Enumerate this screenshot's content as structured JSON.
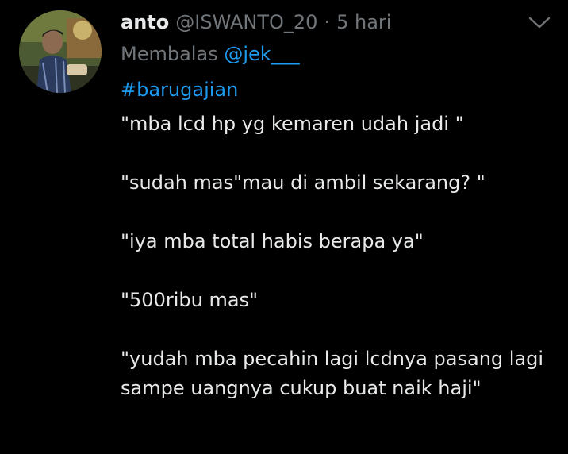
{
  "tweet": {
    "author_name": "anto",
    "author_handle": "@ISWANTO_20",
    "separator": "·",
    "timestamp": "5 hari",
    "reply_prefix": "Membalas",
    "reply_mention": "@jek___",
    "hashtag": "#barugajian",
    "paragraphs": [
      "\"mba lcd hp yg kemaren udah jadi \"",
      "\"sudah mas\"mau di ambil sekarang? \"",
      "\"iya mba total habis berapa ya\"",
      "\"500ribu mas\"",
      "\"yudah mba pecahin lagi lcdnya pasang lagi sampe uangnya cukup buat naik haji\""
    ]
  },
  "icons": {
    "menu": "chevron-down-icon",
    "avatar": "profile-photo"
  },
  "colors": {
    "background": "#000000",
    "text": "#e7e9ea",
    "muted": "#71767b",
    "link": "#1d9bf0"
  }
}
